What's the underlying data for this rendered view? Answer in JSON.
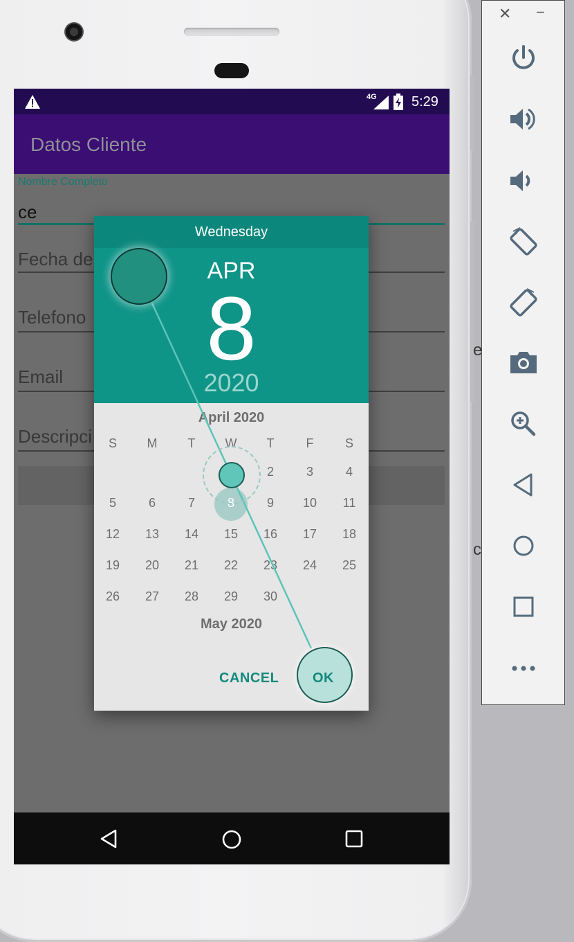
{
  "status_bar": {
    "network": "4G",
    "time": "5:29"
  },
  "app_bar": {
    "title": "Datos Cliente"
  },
  "form": {
    "name_label": "Nombre Completo",
    "name_value": "ce",
    "birthdate_hint": "Fecha de",
    "phone_hint": "Telefono",
    "email_hint": "Email",
    "description_hint": "Descripci"
  },
  "date_picker": {
    "weekday": "Wednesday",
    "month_short": "APR",
    "day": "8",
    "year": "2020",
    "month_title": "April 2020",
    "next_month_title": "May 2020",
    "weekday_headers": [
      "S",
      "M",
      "T",
      "W",
      "T",
      "F",
      "S"
    ],
    "days": [
      "1",
      "2",
      "3",
      "4",
      "5",
      "6",
      "7",
      "8",
      "9",
      "10",
      "11",
      "12",
      "13",
      "14",
      "15",
      "16",
      "17",
      "18",
      "19",
      "20",
      "21",
      "22",
      "23",
      "24",
      "25",
      "26",
      "27",
      "28",
      "29",
      "30"
    ],
    "selected_day": "8",
    "cancel_label": "CANCEL",
    "ok_label": "OK"
  },
  "colors": {
    "accent": "#0f9488",
    "app_bar": "#3a0e72",
    "status_bar": "#230b52"
  },
  "emulator_toolbar": {
    "items": [
      "power-icon",
      "volume-up-icon",
      "volume-down-icon",
      "rotate-left-icon",
      "rotate-right-icon",
      "camera-icon",
      "zoom-icon",
      "back-icon",
      "home-icon",
      "overview-icon",
      "more-icon"
    ]
  }
}
